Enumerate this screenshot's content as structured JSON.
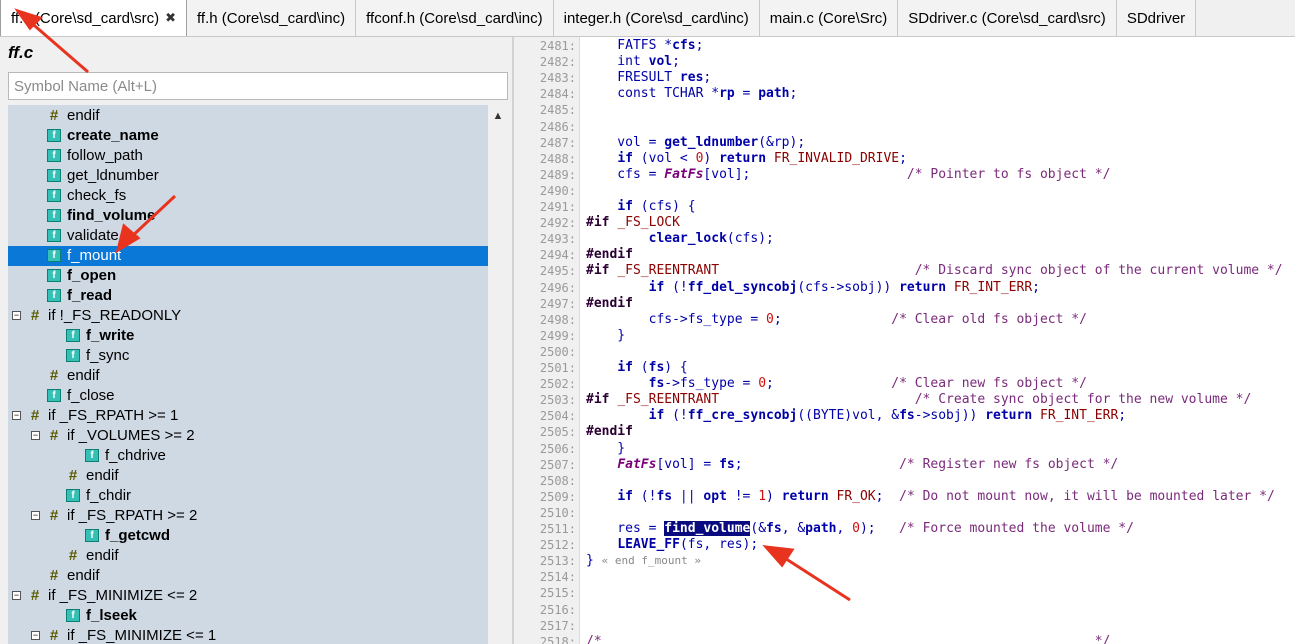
{
  "tabs": [
    {
      "label": "ff.c (Core\\sd_card\\src)",
      "active": true,
      "close": "✖"
    },
    {
      "label": "ff.h (Core\\sd_card\\inc)"
    },
    {
      "label": "ffconf.h (Core\\sd_card\\inc)"
    },
    {
      "label": "integer.h (Core\\sd_card\\inc)"
    },
    {
      "label": "main.c (Core\\Src)"
    },
    {
      "label": "SDdriver.c (Core\\sd_card\\src)"
    },
    {
      "label": "SDdriver"
    }
  ],
  "symbol_panel": {
    "file_title": "ff.c",
    "search_placeholder": "Symbol Name (Alt+L)",
    "items": [
      {
        "label": "endif",
        "icon": "hash-icon",
        "bold": false,
        "depth": 1
      },
      {
        "label": "create_name",
        "icon": "function-icon",
        "bold": true,
        "depth": 1
      },
      {
        "label": "follow_path",
        "icon": "function-icon",
        "bold": false,
        "depth": 1
      },
      {
        "label": "get_ldnumber",
        "icon": "function-icon",
        "bold": false,
        "depth": 1
      },
      {
        "label": "check_fs",
        "icon": "function-icon",
        "bold": false,
        "depth": 1
      },
      {
        "label": "find_volume",
        "icon": "function-icon",
        "bold": true,
        "depth": 1
      },
      {
        "label": "validate",
        "icon": "function-icon",
        "bold": false,
        "depth": 1
      },
      {
        "label": "f_mount",
        "icon": "function-icon",
        "bold": false,
        "depth": 1,
        "selected": true
      },
      {
        "label": "f_open",
        "icon": "function-icon",
        "bold": true,
        "depth": 1
      },
      {
        "label": "f_read",
        "icon": "function-icon",
        "bold": true,
        "depth": 1
      },
      {
        "label": "if !_FS_READONLY",
        "icon": "hash-icon",
        "bold": false,
        "depth": 0,
        "expander": "−"
      },
      {
        "label": "f_write",
        "icon": "function-icon",
        "bold": true,
        "depth": 2
      },
      {
        "label": "f_sync",
        "icon": "function-icon",
        "bold": false,
        "depth": 2
      },
      {
        "label": "endif",
        "icon": "hash-icon",
        "bold": false,
        "depth": 1
      },
      {
        "label": "f_close",
        "icon": "function-icon",
        "bold": false,
        "depth": 1
      },
      {
        "label": "if _FS_RPATH >= 1",
        "icon": "hash-icon",
        "bold": false,
        "depth": 0,
        "expander": "−"
      },
      {
        "label": "if _VOLUMES >= 2",
        "icon": "hash-icon",
        "bold": false,
        "depth": 1,
        "expander": "−"
      },
      {
        "label": "f_chdrive",
        "icon": "function-icon",
        "bold": false,
        "depth": 3
      },
      {
        "label": "endif",
        "icon": "hash-icon",
        "bold": false,
        "depth": 2
      },
      {
        "label": "f_chdir",
        "icon": "function-icon",
        "bold": false,
        "depth": 2
      },
      {
        "label": "if _FS_RPATH >= 2",
        "icon": "hash-icon",
        "bold": false,
        "depth": 1,
        "expander": "−"
      },
      {
        "label": "f_getcwd",
        "icon": "function-icon",
        "bold": true,
        "depth": 3
      },
      {
        "label": "endif",
        "icon": "hash-icon",
        "bold": false,
        "depth": 2
      },
      {
        "label": "endif",
        "icon": "hash-icon",
        "bold": false,
        "depth": 1
      },
      {
        "label": "if _FS_MINIMIZE <= 2",
        "icon": "hash-icon",
        "bold": false,
        "depth": 0,
        "expander": "−"
      },
      {
        "label": "f_lseek",
        "icon": "function-icon",
        "bold": true,
        "depth": 2
      },
      {
        "label": "if _FS_MINIMIZE <= 1",
        "icon": "hash-icon",
        "bold": false,
        "depth": 1,
        "expander": "−"
      }
    ]
  },
  "code": {
    "lines": [
      {
        "n": "2481:",
        "html": "    FATFS *<span class=\"bd\">cfs</span>;"
      },
      {
        "n": "2482:",
        "html": "    int <span class=\"bd\">vol</span>;"
      },
      {
        "n": "2483:",
        "html": "    FRESULT <span class=\"bd\">res</span>;"
      },
      {
        "n": "2484:",
        "html": "    const TCHAR *<span class=\"bd\">rp</span> = <span class=\"bd\">path</span>;"
      },
      {
        "n": "2485:",
        "html": ""
      },
      {
        "n": "2486:",
        "html": ""
      },
      {
        "n": "2487:",
        "html": "    vol = <span class=\"bd\">get_ldnumber</span>(&amp;rp);"
      },
      {
        "n": "2488:",
        "html": "    <span class=\"kw\">if</span> (vol &lt; <span class=\"nm\">0</span>) <span class=\"kw\">return</span> <span class=\"mc\">FR_INVALID_DRIVE</span>;"
      },
      {
        "n": "2489:",
        "html": "    cfs = <span class=\"it\">FatFs</span>[vol];                    <span class=\"cm\">/* Pointer to fs object */</span>"
      },
      {
        "n": "2490:",
        "html": ""
      },
      {
        "n": "2491:",
        "html": "    <span class=\"kw\">if</span> (cfs) {"
      },
      {
        "n": "2492:",
        "html": "<span class=\"pp\">#if</span> <span class=\"mc\">_FS_LOCK</span>"
      },
      {
        "n": "2493:",
        "html": "        <span class=\"bd\">clear_lock</span>(cfs);"
      },
      {
        "n": "2494:",
        "html": "<span class=\"pp\">#endif</span>"
      },
      {
        "n": "2495:",
        "html": "<span class=\"pp\">#if</span> <span class=\"mc\">_FS_REENTRANT</span>                         <span class=\"cm\">/* Discard sync object of the current volume */</span>"
      },
      {
        "n": "2496:",
        "html": "        <span class=\"kw\">if</span> (!<span class=\"bd\">ff_del_syncobj</span>(cfs-&gt;sobj)) <span class=\"kw\">return</span> <span class=\"mc\">FR_INT_ERR</span>;"
      },
      {
        "n": "2497:",
        "html": "<span class=\"pp\">#endif</span>"
      },
      {
        "n": "2498:",
        "html": "        cfs-&gt;fs_type = <span class=\"nm\">0</span>;              <span class=\"cm\">/* Clear old fs object */</span>"
      },
      {
        "n": "2499:",
        "html": "    }"
      },
      {
        "n": "2500:",
        "html": ""
      },
      {
        "n": "2501:",
        "html": "    <span class=\"kw\">if</span> (<span class=\"bd\">fs</span>) {"
      },
      {
        "n": "2502:",
        "html": "        <span class=\"bd\">fs</span>-&gt;fs_type = <span class=\"nm\">0</span>;               <span class=\"cm\">/* Clear new fs object */</span>"
      },
      {
        "n": "2503:",
        "html": "<span class=\"pp\">#if</span> <span class=\"mc\">_FS_REENTRANT</span>                         <span class=\"cm\">/* Create sync object for the new volume */</span>"
      },
      {
        "n": "2504:",
        "html": "        <span class=\"kw\">if</span> (!<span class=\"bd\">ff_cre_syncobj</span>((BYTE)vol, &amp;<span class=\"bd\">fs</span>-&gt;sobj)) <span class=\"kw\">return</span> <span class=\"mc\">FR_INT_ERR</span>;"
      },
      {
        "n": "2505:",
        "html": "<span class=\"pp\">#endif</span>"
      },
      {
        "n": "2506:",
        "html": "    }"
      },
      {
        "n": "2507:",
        "html": "    <span class=\"it\">FatFs</span>[vol] = <span class=\"bd\">fs</span>;                    <span class=\"cm\">/* Register new fs object */</span>"
      },
      {
        "n": "2508:",
        "html": ""
      },
      {
        "n": "2509:",
        "html": "    <span class=\"kw\">if</span> (!<span class=\"bd\">fs</span> || <span class=\"bd\">opt</span> != <span class=\"nm\">1</span>) <span class=\"kw\">return</span> <span class=\"mc\">FR_OK</span>;  <span class=\"cm\">/* Do not mount now, it will be mounted later */</span>"
      },
      {
        "n": "2510:",
        "html": ""
      },
      {
        "n": "2511:",
        "html": "    res = <span class=\"hl\">find_volume</span>(&amp;<span class=\"bd\">fs</span>, &amp;<span class=\"bd\">path</span>, <span class=\"nm\">0</span>);   <span class=\"cm\">/* Force mounted the volume */</span>"
      },
      {
        "n": "2512:",
        "html": "    <span class=\"bd\">LEAVE_FF</span>(fs, res);"
      },
      {
        "n": "2513:",
        "html": "} <span class=\"endc\">« end f_mount »</span>"
      },
      {
        "n": "2514:",
        "html": ""
      },
      {
        "n": "2515:",
        "html": ""
      },
      {
        "n": "2516:",
        "html": ""
      },
      {
        "n": "2517:",
        "html": ""
      },
      {
        "n": "2518:",
        "html": "<span class=\"cm\">/*                                                               */</span>"
      }
    ]
  },
  "colors": {
    "selection": "#0a78d7",
    "tree_background": "#cfd9e4",
    "annotation_arrow": "#e8331f"
  }
}
